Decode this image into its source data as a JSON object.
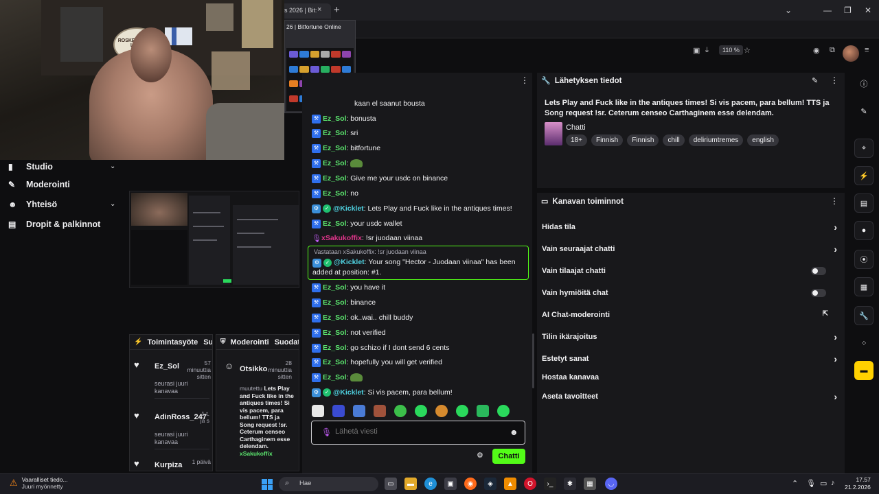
{
  "browser": {
    "tab_title": "s 2026 | Bit:",
    "tab_close": "×",
    "new_tab": "+",
    "zoom": "110 %",
    "window_controls": {
      "minimize": "—",
      "restore": "❐",
      "close": "✕",
      "dropdown": "⌄"
    },
    "preview_title": "26 | Bitfortune Online"
  },
  "cam": {
    "badge_text": "ROSKENKORVA LIINA"
  },
  "sidebar": {
    "items": [
      {
        "label": "Studio",
        "icon": "video-icon",
        "has_chevron": true
      },
      {
        "label": "Moderointi",
        "icon": "wrench-icon",
        "has_chevron": false
      },
      {
        "label": "Yhteisö",
        "icon": "community-icon",
        "has_chevron": true
      },
      {
        "label": "Dropit & palkinnot",
        "icon": "gift-icon",
        "has_chevron": false
      }
    ]
  },
  "activity_panel": {
    "title": "Toimintasyöte",
    "filter": "Suod",
    "items": [
      {
        "name": "Ez_Sol",
        "time": "57 minuuttia sitten",
        "desc": "seurasi juuri kanavaa"
      },
      {
        "name": "AdinRoss_247",
        "time": "1 t. ja s",
        "desc": "seurasi juuri kanavaa"
      },
      {
        "name": "Kurpiza",
        "time": "1 päivä",
        "desc": ""
      }
    ]
  },
  "moderation_panel": {
    "title": "Moderointi",
    "filter": "Suodata",
    "item": {
      "name": "Otsikko",
      "time": "28 minuuttia sitten",
      "prefix": "muutettu",
      "text": "Lets Play and Fuck like in the antiques times! Si vis pacem, para bellum! TTS ja Song request !sr. Ceterum censeo Carthaginem esse delendam.",
      "by": "xSakukoffix"
    }
  },
  "chat": {
    "top_partial": "kaan el saanut bousta",
    "messages": [
      {
        "user": "Ez_Sol",
        "type": "ez",
        "text": ": bonusta"
      },
      {
        "user": "Ez_Sol",
        "type": "ez",
        "text": ": sri"
      },
      {
        "user": "Ez_Sol",
        "type": "ez",
        "text": ": bitfortune"
      },
      {
        "user": "Ez_Sol",
        "type": "ez",
        "text": ":",
        "emote": true
      },
      {
        "user": "Ez_Sol",
        "type": "ez",
        "text": ": Give me your usdc on binance"
      },
      {
        "user": "Ez_Sol",
        "type": "ez",
        "text": ": no"
      },
      {
        "user": "@Kicklet",
        "type": "kick",
        "text": ": Lets Play and Fuck like in the antiques times!"
      },
      {
        "user": "Ez_Sol",
        "type": "ez",
        "text": ": your usdc wallet"
      },
      {
        "user": "xSakukoffix",
        "type": "sak",
        "text": ": !sr juodaan viinaa"
      }
    ],
    "reply": {
      "note": "Vastataan xSakukoffix: !sr juodaan viinaa",
      "user": "@Kicklet",
      "text": ": Your song \"Hector - Juodaan viinaa\" has been added at position: #1."
    },
    "messages2": [
      {
        "user": "Ez_Sol",
        "type": "ez",
        "text": ": you have it"
      },
      {
        "user": "Ez_Sol",
        "type": "ez",
        "text": ": binance"
      },
      {
        "user": "Ez_Sol",
        "type": "ez",
        "text": ": ok..wai.. chill buddy"
      },
      {
        "user": "Ez_Sol",
        "type": "ez",
        "text": ": not verified"
      },
      {
        "user": "Ez_Sol",
        "type": "ez",
        "text": ": go schizo if I dont send 6 cents"
      },
      {
        "user": "Ez_Sol",
        "type": "ez",
        "text": ": hopefully you will get verified"
      },
      {
        "user": "Ez_Sol",
        "type": "ez",
        "text": ":",
        "emote": true
      },
      {
        "user": "@Kicklet",
        "type": "kick",
        "text": ": Si vis pacem, para bellum!"
      }
    ],
    "input_placeholder": "Lähetä viesti",
    "send_label": "Chatti"
  },
  "info_panel": {
    "heading": "Lähetyksen tiedot",
    "title": "Lets Play and Fuck like in the antiques times! Si vis pacem, para bellum! TTS ja Song request !sr. Ceterum censeo Carthaginem esse delendam.",
    "category": "Chatti",
    "tags": [
      "18+",
      "Finnish",
      "Finnish",
      "chill",
      "deliriumtremes",
      "english"
    ]
  },
  "channel_actions": {
    "heading": "Kanavan toiminnot",
    "rows": [
      {
        "label": "Hidas tila",
        "kind": "arrow"
      },
      {
        "label": "Vain seuraajat chatti",
        "kind": "arrow"
      },
      {
        "label": "Vain tilaajat chatti",
        "kind": "toggle"
      },
      {
        "label": "Vain hymiöitä chat",
        "kind": "toggle"
      },
      {
        "label": "AI Chat-moderointi",
        "kind": "external"
      },
      {
        "label": "Tilin ikärajoitus",
        "kind": "arrow"
      },
      {
        "label": "Estetyt sanat",
        "kind": "arrow"
      },
      {
        "label": "Hostaa kanavaa",
        "kind": "none"
      },
      {
        "label": "Aseta tavoitteet",
        "kind": "arrow"
      }
    ]
  },
  "taskbar": {
    "notice_title": "Vaaralliset tiedo...",
    "notice_sub": "Juuri myönnetty",
    "search": "Hae",
    "time": "17.57",
    "date": "21.2.2026"
  }
}
